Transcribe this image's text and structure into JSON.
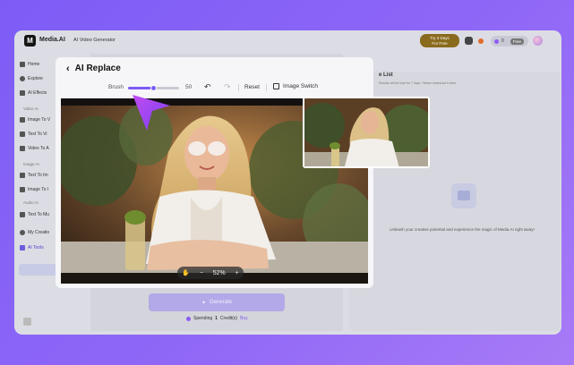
{
  "app": {
    "brand": "Media.AI",
    "nav_link": "AI Video Generator",
    "trial": {
      "line1": "Try 3 Days",
      "line2": "For Free"
    },
    "credits_count": "0",
    "plan_badge": "Free"
  },
  "sidebar": {
    "items": [
      {
        "label": "Home",
        "icon": "home-icon"
      },
      {
        "label": "Explore",
        "icon": "compass-icon"
      },
      {
        "label": "AI Effects",
        "icon": "sparkle-icon"
      },
      {
        "label": "Image To V",
        "icon": "image-video-icon"
      },
      {
        "label": "Text To Vi",
        "icon": "text-video-icon"
      },
      {
        "label": "Video To A",
        "icon": "video-icon"
      },
      {
        "label": "Text To Im",
        "icon": "text-image-icon"
      },
      {
        "label": "Image To I",
        "icon": "image-image-icon"
      },
      {
        "label": "Text To Mu",
        "icon": "music-icon"
      },
      {
        "label": "My Creatio",
        "icon": "folder-icon"
      },
      {
        "label": "AI Tools",
        "icon": "grid-icon"
      }
    ],
    "sections": [
      "Video AI",
      "Image AI",
      "Audio AI"
    ]
  },
  "generate": {
    "button_label": "Generate",
    "spending_prefix": "Spending",
    "spending_amount": "1",
    "spending_suffix": "Credit(s)",
    "buy_label": "Buy"
  },
  "right_panel": {
    "title": "e List",
    "subtitle": "Results will be kept for 7 days. Please download in time.",
    "empty_text": "Unleash your creative potential and experience the magic of Media.AI right away!"
  },
  "modal": {
    "title": "AI Replace",
    "brush_label": "Brush",
    "brush_value": 50,
    "brush_max": 100,
    "reset_label": "Reset",
    "image_switch_label": "Image Switch",
    "zoom_label": "52%",
    "zoom_minus": "−",
    "zoom_plus": "+",
    "undo_symbol": "↶",
    "redo_symbol": "↷"
  },
  "colors": {
    "accent": "#7d5cf6",
    "background_gradient_start": "#7d5cf6",
    "background_gradient_end": "#a77af6"
  }
}
